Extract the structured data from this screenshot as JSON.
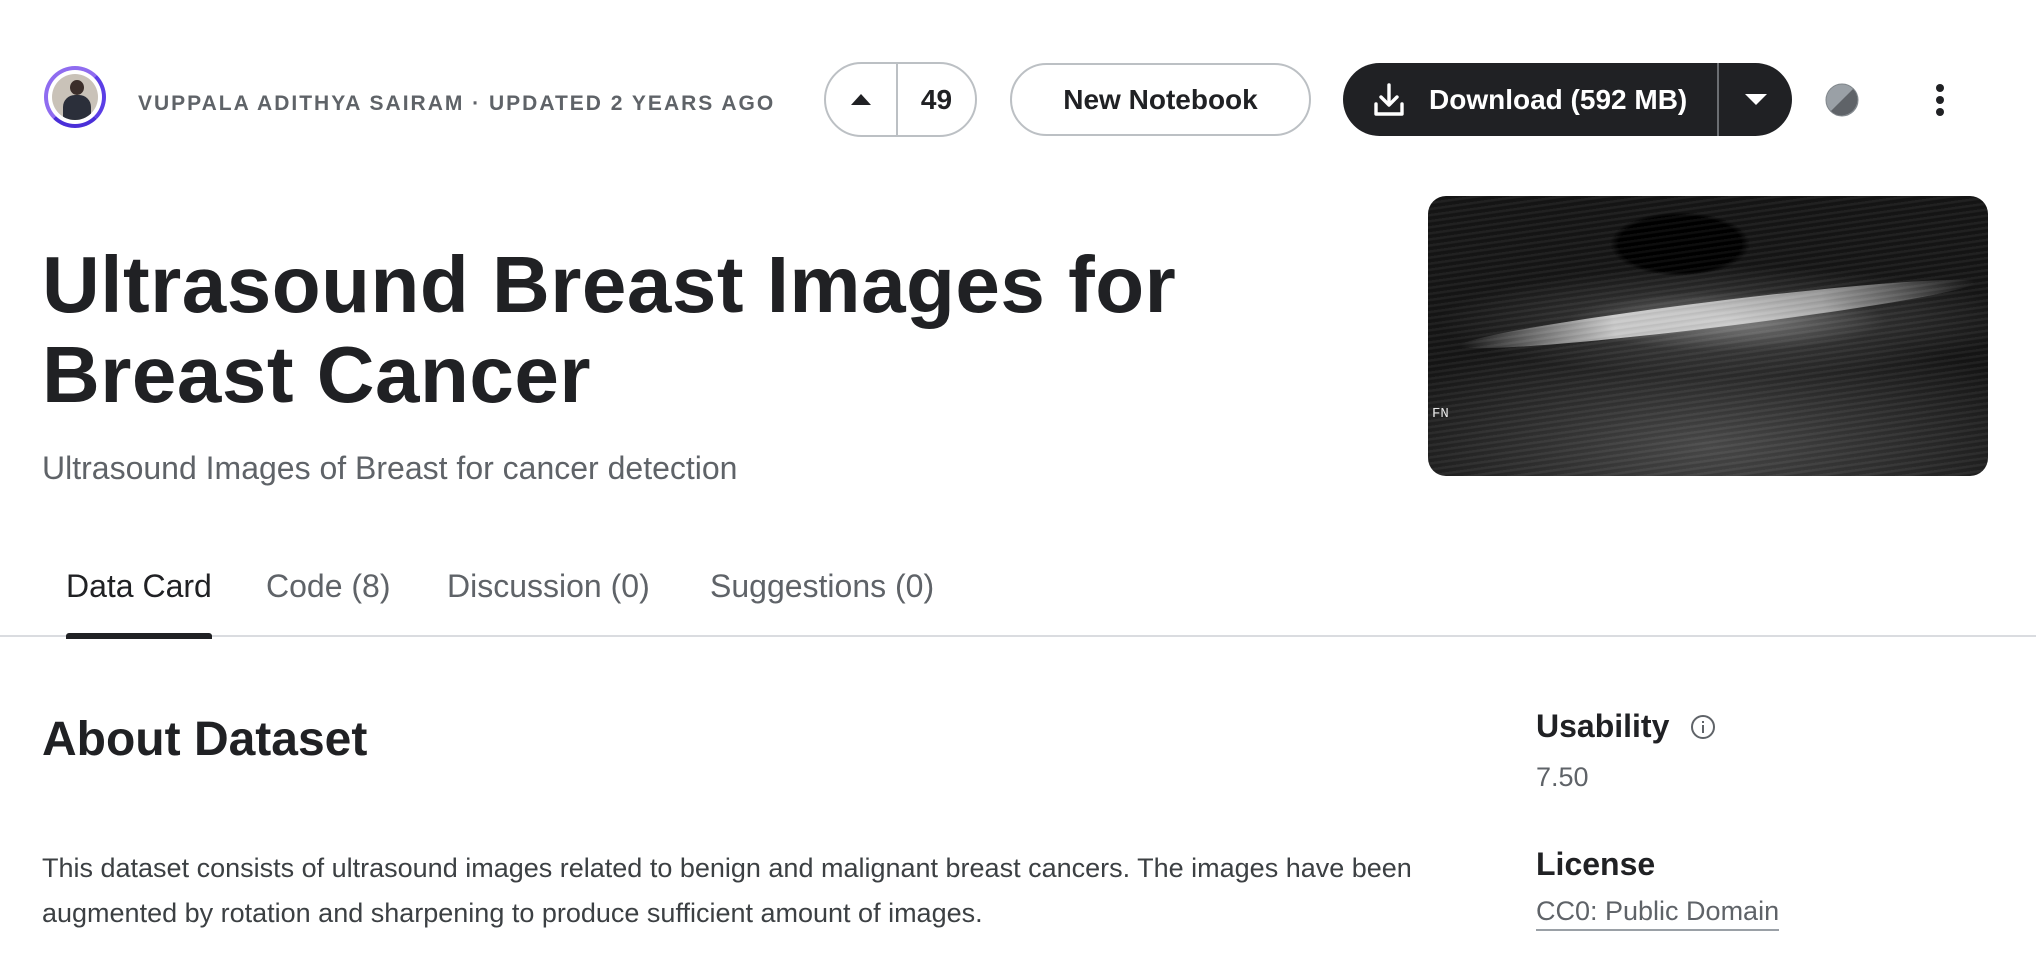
{
  "header": {
    "author_line": "VUPPALA ADITHYA SAIRAM · UPDATED 2 YEARS AGO",
    "vote_count": "49",
    "new_notebook_label": "New Notebook",
    "download_label": "Download (592 MB)"
  },
  "dataset": {
    "title": "Ultrasound Breast Images for Breast Cancer",
    "subtitle": "Ultrasound Images of Breast for cancer detection",
    "image_mark": "FN"
  },
  "tabs": [
    {
      "label": "Data Card",
      "active": true
    },
    {
      "label": "Code (8)",
      "active": false
    },
    {
      "label": "Discussion (0)",
      "active": false
    },
    {
      "label": "Suggestions (0)",
      "active": false
    }
  ],
  "about": {
    "heading": "About Dataset",
    "body": "This dataset consists of ultrasound images related to benign and malignant breast cancers. The images have been augmented by rotation and sharpening to produce sufficient amount of images."
  },
  "sidebar": {
    "usability_label": "Usability",
    "usability_value": "7.50",
    "license_label": "License",
    "license_value": "CC0: Public Domain"
  },
  "colors": {
    "primary": "#202124",
    "muted_text": "#5f6368",
    "border": "#dadce0",
    "avatar_ring": "#5b3ee6"
  },
  "icons": [
    "upvote-icon",
    "download-icon",
    "chevron-down-icon",
    "contrast-icon",
    "more-vert-icon",
    "info-icon"
  ]
}
